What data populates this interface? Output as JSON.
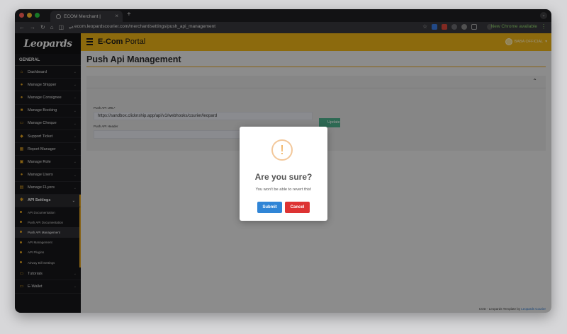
{
  "browser": {
    "tab_title": "ECOM Merchant |",
    "tab_close": "×",
    "new_tab": "+",
    "url": "ecom.leopardscourier.com/merchant/settings/push_api_management",
    "new_chrome": "New Chrome available",
    "menu": "⋮"
  },
  "sidebar": {
    "logo": "Leopards",
    "section": "GENERAL",
    "items": [
      {
        "label": "Dashboard",
        "icon": "home-icon",
        "glyph": "⌂"
      },
      {
        "label": "Manage Shipper",
        "icon": "user-icon",
        "glyph": "●"
      },
      {
        "label": "Manage Consignee",
        "icon": "user-icon",
        "glyph": "●"
      },
      {
        "label": "Manage Booking",
        "icon": "book-icon",
        "glyph": "■"
      },
      {
        "label": "Manage Cheque",
        "icon": "cheque-icon",
        "glyph": "▭"
      },
      {
        "label": "Support Ticket",
        "icon": "ticket-icon",
        "glyph": "◆"
      },
      {
        "label": "Report Manager",
        "icon": "table-icon",
        "glyph": "▦"
      },
      {
        "label": "Manage Role",
        "icon": "lock-icon",
        "glyph": "▣"
      },
      {
        "label": "Manage Users",
        "icon": "users-icon",
        "glyph": "●"
      },
      {
        "label": "Manage FLyers",
        "icon": "flyer-icon",
        "glyph": "▤"
      }
    ],
    "active": {
      "label": "API Settings",
      "icon": "gear-icon",
      "glyph": "✱"
    },
    "sub_items": [
      {
        "label": "API Documentation"
      },
      {
        "label": "Push API Documentation"
      },
      {
        "label": "Push API Management"
      },
      {
        "label": "API Management"
      },
      {
        "label": "API Plugins"
      },
      {
        "label": "Airway Bill Settings"
      }
    ],
    "bottom_items": [
      {
        "label": "Tutorials",
        "icon": "monitor-icon",
        "glyph": "▭"
      },
      {
        "label": "E-Wallet",
        "icon": "wallet-icon",
        "glyph": "▭"
      }
    ]
  },
  "topbar": {
    "brand_bold": "E-Com",
    "brand_rest": "Portal",
    "user": "BABA OFFICIAL",
    "user_caret": "▾"
  },
  "page": {
    "title": "Push Api Management",
    "form": {
      "url_label": "Push API URL*",
      "url_value": "https://sandbox.clicknship.app/api/v1/webhooks/courier/leopard",
      "header_label": "Push API Header",
      "header_value": "",
      "update_label": "Update",
      "collapse_glyph": "⌃"
    }
  },
  "footer": {
    "text": "COD - Leopards Template by",
    "link": "Leopards Courier"
  },
  "modal": {
    "icon": "!",
    "title": "Are you sure?",
    "text": "You won't be able to revert this!",
    "submit": "Submit",
    "cancel": "Cancel"
  },
  "colors": {
    "accent": "#eab117",
    "sidebar": "#17171a",
    "submit": "#3085d6",
    "cancel": "#dd3333",
    "update": "#4caf8a"
  }
}
